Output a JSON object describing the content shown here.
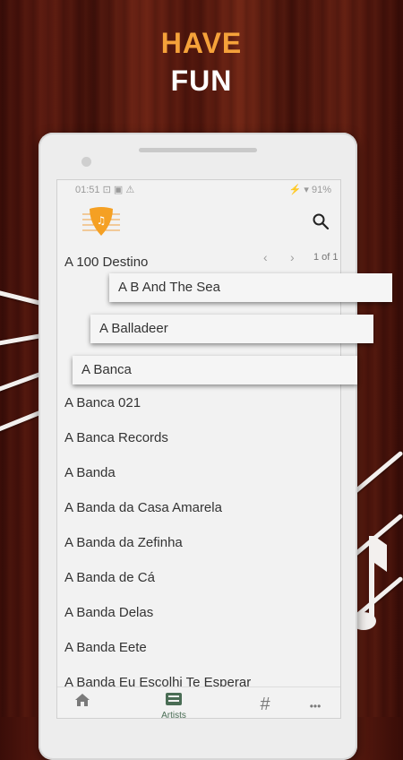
{
  "promo": {
    "line1": "HAVE",
    "line2": "FUN"
  },
  "status": {
    "time": "01:51",
    "icons_left": "⊡ ▣ ⚠",
    "right": "⚡ ▾ 91%"
  },
  "app": {
    "logo_icon": "guitar-pick-music-icon",
    "search_icon": "search-icon"
  },
  "pager": {
    "prev": "‹",
    "next": "›",
    "count": "1 of 1"
  },
  "artists": [
    "A 100 Destino",
    "A Banca 021",
    "A Banca Records",
    "A Banda",
    "A Banda da Casa Amarela",
    "A Banda da Zefinha",
    "A Banda de Cá",
    "A Banda Delas",
    "A Banda Eete",
    "A Banda Eu Escolhi Te Esperar"
  ],
  "floating_cards": [
    "A B And The Sea",
    "A Balladeer",
    "A Banca"
  ],
  "bottom_nav": {
    "home_icon": "home-icon",
    "artists_label": "Artists",
    "artists_icon": "keyboard-icon",
    "hash_icon": "#",
    "more_icon": "•••"
  },
  "colors": {
    "accent_orange": "#f5a23a",
    "nav_green": "#4a6d55",
    "wood": "#4a130b"
  }
}
